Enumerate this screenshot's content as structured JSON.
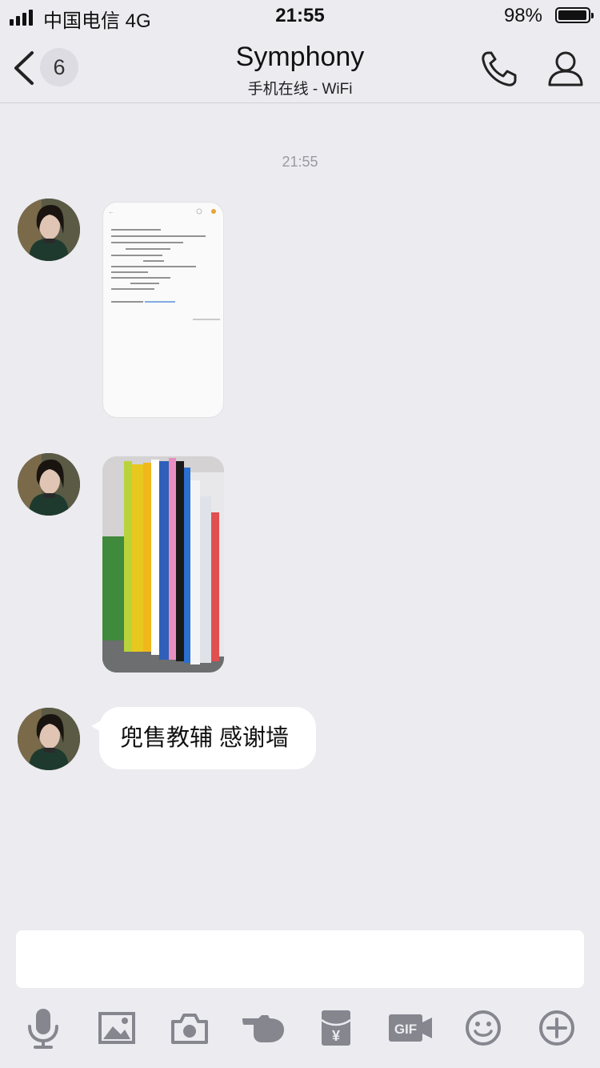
{
  "status_bar": {
    "carrier": "中国电信   4G",
    "time": "21:55",
    "battery_percent": "98%",
    "battery_level": 0.98
  },
  "header": {
    "back_icon": "chevron-left-icon",
    "unread_count": "6",
    "title": "Symphony",
    "subtitle": "手机在线 - WiFi",
    "actions": [
      "phone-icon",
      "contact-profile-icon"
    ]
  },
  "chat": {
    "timestamp": "21:55",
    "messages": [
      {
        "type": "image",
        "content": "screenshot of a note listing textbooks"
      },
      {
        "type": "image",
        "content": "photo of a row of textbooks on a shelf"
      },
      {
        "type": "text",
        "text": "兜售教辅 感谢墙"
      }
    ]
  },
  "input": {
    "placeholder": ""
  },
  "toolbar": {
    "icons": [
      "microphone-icon",
      "image-icon",
      "camera-icon",
      "poke-hand-icon",
      "red-packet-icon",
      "gif-icon",
      "emoji-icon",
      "plus-icon"
    ],
    "gif_label": "GIF",
    "red_packet_symbol": "¥"
  },
  "colors": {
    "background": "#ebebf0",
    "icon_gray": "#86868f",
    "bubble": "#ffffff",
    "text": "#111111"
  }
}
